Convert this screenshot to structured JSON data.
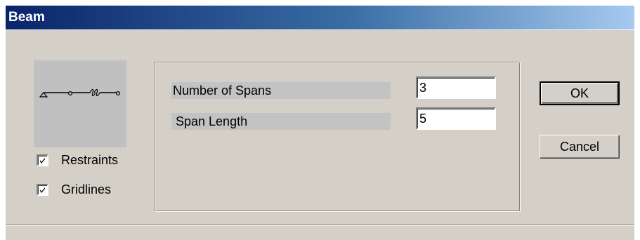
{
  "window": {
    "title": "Beam"
  },
  "preview": {
    "icon": "beam-diagram-icon"
  },
  "options": {
    "restraints": {
      "label": "Restraints",
      "checked": true
    },
    "gridlines": {
      "label": "Gridlines",
      "checked": true
    }
  },
  "fields": {
    "num_spans": {
      "label": "Number of Spans",
      "value": "3"
    },
    "span_length": {
      "label": "Span Length",
      "value": "5"
    }
  },
  "buttons": {
    "ok": "OK",
    "cancel": "Cancel"
  },
  "colors": {
    "title_gradient_start": "#0a246a",
    "title_gradient_end": "#a6caf0",
    "dialog_face": "#d4d0c8",
    "label_bg": "#c3c3c3"
  }
}
